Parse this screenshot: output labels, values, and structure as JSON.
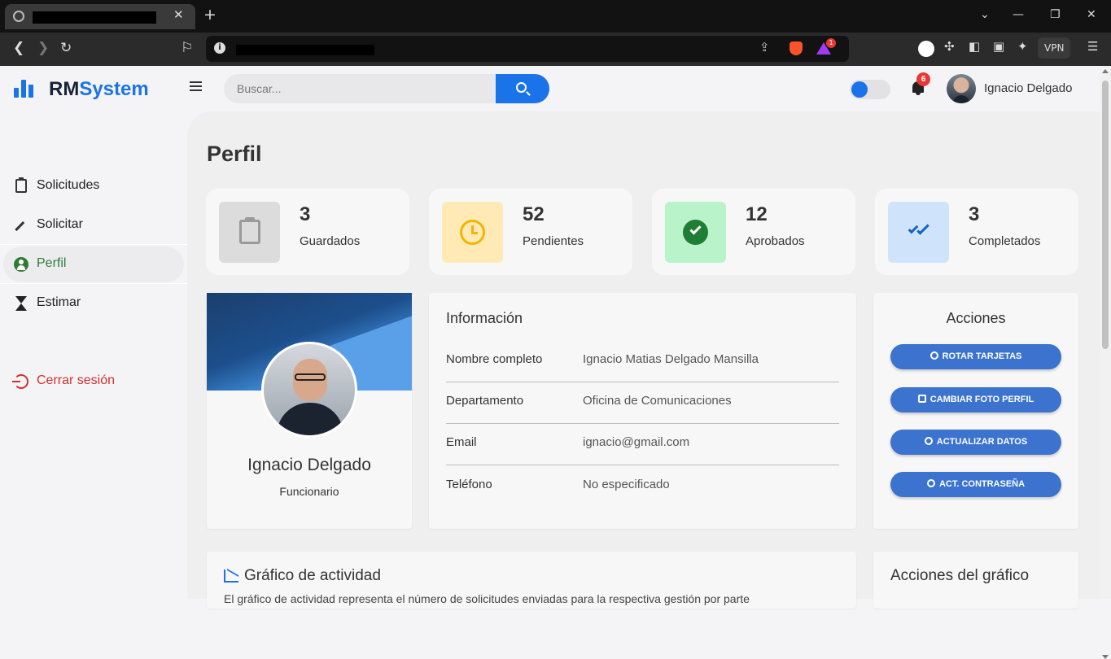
{
  "app": {
    "logo_prefix": "RM",
    "logo_highlight": "System",
    "search_placeholder": "Buscar...",
    "notifications_count": "6",
    "user_name": "Ignacio Delgado",
    "theme_toggle_on": true,
    "accent_color": "#1a73e8"
  },
  "browser": {
    "vpn_label": "VPN",
    "bat_badge": "1"
  },
  "sidebar": {
    "items": [
      {
        "label": "Solicitudes",
        "icon": "clipboard-icon"
      },
      {
        "label": "Solicitar",
        "icon": "pencil-icon"
      },
      {
        "label": "Perfil",
        "icon": "user-circle-icon",
        "active": true
      },
      {
        "label": "Estimar",
        "icon": "hourglass-icon"
      }
    ],
    "logout_label": "Cerrar sesión"
  },
  "page": {
    "title": "Perfil"
  },
  "stats": [
    {
      "value": "3",
      "label": "Guardados",
      "icon": "clipboard-icon",
      "bg": "#dcdcdc"
    },
    {
      "value": "52",
      "label": "Pendientes",
      "icon": "clock-icon",
      "bg": "#ffeab5"
    },
    {
      "value": "12",
      "label": "Aprobados",
      "icon": "check-circle-icon",
      "bg": "#b9f3c9"
    },
    {
      "value": "3",
      "label": "Completados",
      "icon": "double-check-icon",
      "bg": "#cfe4fb"
    }
  ],
  "profile": {
    "name": "Ignacio Delgado",
    "role": "Funcionario"
  },
  "info": {
    "title": "Información",
    "rows": [
      {
        "key": "Nombre completo",
        "value": "Ignacio Matias Delgado Mansilla"
      },
      {
        "key": "Departamento",
        "value": "Oficina de Comunicaciones"
      },
      {
        "key": "Email",
        "value": "ignacio@gmail.com"
      },
      {
        "key": "Teléfono",
        "value": "No especificado"
      }
    ]
  },
  "actions": {
    "title": "Acciones",
    "buttons": [
      {
        "label": "ROTAR TARJETAS",
        "icon": "refresh-icon"
      },
      {
        "label": "CAMBIAR FOTO PERFIL",
        "icon": "camera-icon"
      },
      {
        "label": "ACTUALIZAR DATOS",
        "icon": "user-edit-icon"
      },
      {
        "label": "ACT. CONTRASEÑA",
        "icon": "key-icon"
      }
    ]
  },
  "activity": {
    "title": "Gráfico de actividad",
    "description": "El gráfico de actividad representa el número de solicitudes enviadas para la respectiva gestión por parte",
    "actions_title": "Acciones del gráfico"
  }
}
